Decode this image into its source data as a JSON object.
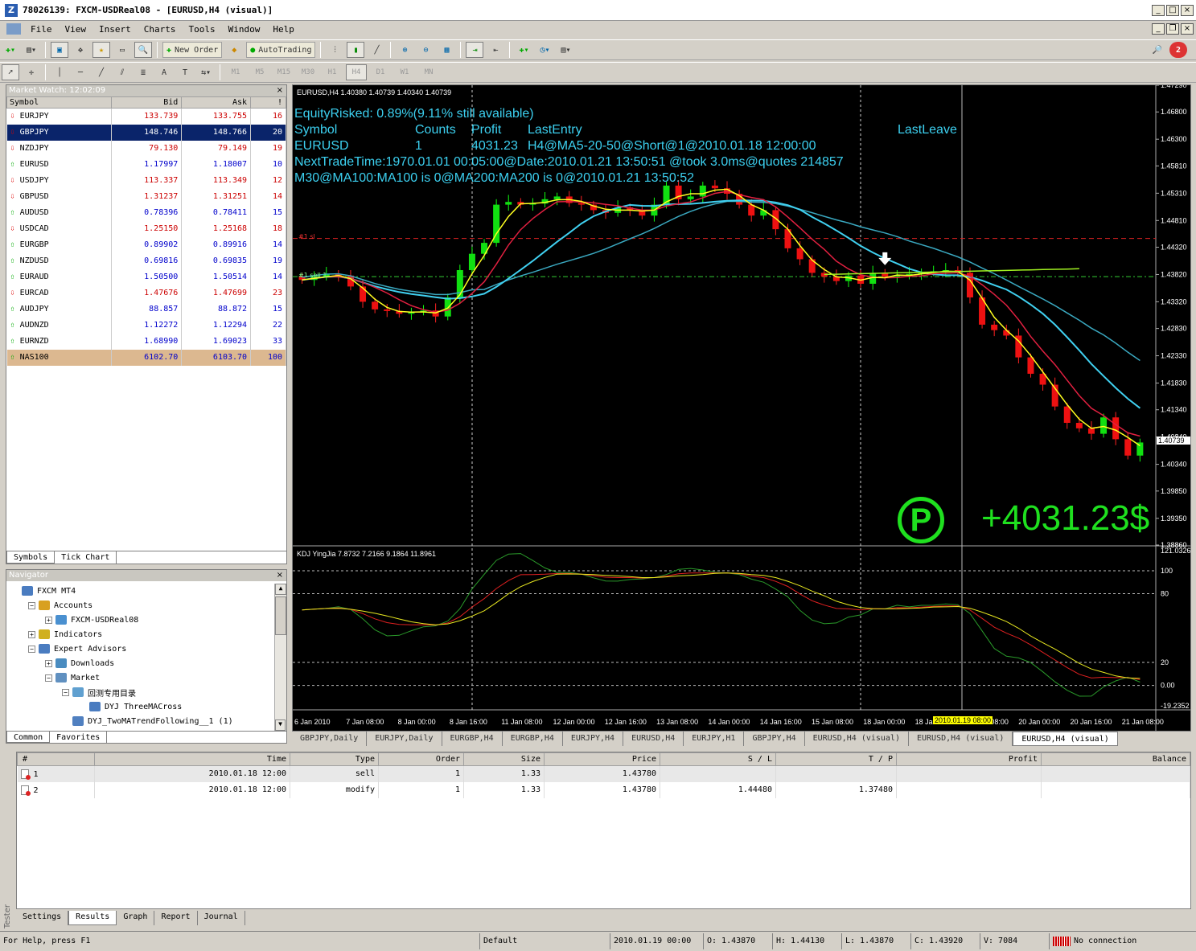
{
  "window": {
    "title": "78026139: FXCM-USDReal08 - [EURUSD,H4 (visual)]",
    "app_icon": "Z"
  },
  "menu": [
    "File",
    "View",
    "Insert",
    "Charts",
    "Tools",
    "Window",
    "Help"
  ],
  "toolbar": {
    "new_order": "New Order",
    "autotrading": "AutoTrading",
    "timeframes": [
      "M1",
      "M5",
      "M15",
      "M30",
      "H1",
      "H4",
      "D1",
      "W1",
      "MN"
    ],
    "alert_count": "2"
  },
  "market_watch": {
    "title": "Market Watch: 12:02:09",
    "close": "×",
    "columns": [
      "Symbol",
      "Bid",
      "Ask",
      "!"
    ],
    "rows": [
      {
        "symbol": "EURJPY",
        "bid": "133.739",
        "ask": "133.755",
        "spread": "16",
        "dir": "down"
      },
      {
        "symbol": "GBPJPY",
        "bid": "148.746",
        "ask": "148.766",
        "spread": "20",
        "dir": "down"
      },
      {
        "symbol": "NZDJPY",
        "bid": "79.130",
        "ask": "79.149",
        "spread": "19",
        "dir": "down"
      },
      {
        "symbol": "EURUSD",
        "bid": "1.17997",
        "ask": "1.18007",
        "spread": "10",
        "dir": "up"
      },
      {
        "symbol": "USDJPY",
        "bid": "113.337",
        "ask": "113.349",
        "spread": "12",
        "dir": "down"
      },
      {
        "symbol": "GBPUSD",
        "bid": "1.31237",
        "ask": "1.31251",
        "spread": "14",
        "dir": "down"
      },
      {
        "symbol": "AUDUSD",
        "bid": "0.78396",
        "ask": "0.78411",
        "spread": "15",
        "dir": "up"
      },
      {
        "symbol": "USDCAD",
        "bid": "1.25150",
        "ask": "1.25168",
        "spread": "18",
        "dir": "down"
      },
      {
        "symbol": "EURGBP",
        "bid": "0.89902",
        "ask": "0.89916",
        "spread": "14",
        "dir": "up"
      },
      {
        "symbol": "NZDUSD",
        "bid": "0.69816",
        "ask": "0.69835",
        "spread": "19",
        "dir": "up"
      },
      {
        "symbol": "EURAUD",
        "bid": "1.50500",
        "ask": "1.50514",
        "spread": "14",
        "dir": "up"
      },
      {
        "symbol": "EURCAD",
        "bid": "1.47676",
        "ask": "1.47699",
        "spread": "23",
        "dir": "down"
      },
      {
        "symbol": "AUDJPY",
        "bid": "88.857",
        "ask": "88.872",
        "spread": "15",
        "dir": "up"
      },
      {
        "symbol": "AUDNZD",
        "bid": "1.12272",
        "ask": "1.12294",
        "spread": "22",
        "dir": "up"
      },
      {
        "symbol": "EURNZD",
        "bid": "1.68990",
        "ask": "1.69023",
        "spread": "33",
        "dir": "up"
      },
      {
        "symbol": "NAS100",
        "bid": "6102.70",
        "ask": "6103.70",
        "spread": "100",
        "dir": "up"
      }
    ],
    "tabs": [
      "Symbols",
      "Tick Chart"
    ]
  },
  "navigator": {
    "title": "Navigator",
    "close": "×",
    "items": [
      {
        "label": "FXCM MT4",
        "level": 0,
        "exp": ""
      },
      {
        "label": "Accounts",
        "level": 1,
        "exp": "-"
      },
      {
        "label": "FXCM-USDReal08",
        "level": 2,
        "exp": "+"
      },
      {
        "label": "Indicators",
        "level": 1,
        "exp": "+"
      },
      {
        "label": "Expert Advisors",
        "level": 1,
        "exp": "-"
      },
      {
        "label": "Downloads",
        "level": 2,
        "exp": "+"
      },
      {
        "label": "Market",
        "level": 2,
        "exp": "-"
      },
      {
        "label": "回测专用目录",
        "level": 3,
        "exp": "-"
      },
      {
        "label": "DYJ ThreeMACross",
        "level": 4,
        "exp": ""
      },
      {
        "label": "DYJ_TwoMATrendFollowing__1 (1)",
        "level": 3,
        "exp": ""
      }
    ],
    "tabs": [
      "Common",
      "Favorites"
    ]
  },
  "chart": {
    "header": "EURUSD,H4  1.40380 1.40739 1.40340 1.40739",
    "info_lines": {
      "equity": "EquityRisked: 0.89%(9.11% still available)",
      "hdr_symbol": "Symbol",
      "hdr_counts": "Counts",
      "hdr_profit": "Profit",
      "hdr_lastentry": "LastEntry",
      "hdr_lastleave": "LastLeave",
      "row_symbol": "EURUSD",
      "row_counts": "1",
      "row_profit": "4031.23",
      "row_lastentry": "H4@MA5-20-50@Short@1@2010.01.18 12:00:00",
      "next": "NextTradeTime:1970.01.01 00:05:00@Date:2010.01.21 13:50:51 @took 3.0ms@quotes 214857",
      "m30": "M30@MA100:MA100 is 0@MA200:MA200 is 0@2010.01.21 13:50:52"
    },
    "sl_label": "#1 sl",
    "sell_label": "#1 sell 1.",
    "profit_big": "+4031.23$",
    "profit_badge": "P",
    "price_ticks": [
      "1.47290",
      "1.46800",
      "1.46300",
      "1.45810",
      "1.45310",
      "1.44810",
      "1.44320",
      "1.43820",
      "1.43320",
      "1.42830",
      "1.42330",
      "1.41830",
      "1.41340",
      "1.40840",
      "1.40340",
      "1.39850",
      "1.39350",
      "1.38860"
    ],
    "current_price": "1.40739",
    "ylim": [
      1.3886,
      1.4729
    ],
    "kdj": {
      "header": "KDJ YingJia 7.8732 7.2166 9.1864 11.8961",
      "ticks": [
        "121.0326",
        "100",
        "80",
        "20",
        "0.00",
        "-19.2352"
      ],
      "ylim": [
        -19.2352,
        121.0326
      ],
      "levels": [
        100,
        80,
        20,
        0
      ]
    },
    "time_labels": [
      "6 Jan 2010",
      "7 Jan 08:00",
      "8 Jan 00:00",
      "8 Jan 16:00",
      "11 Jan 08:00",
      "12 Jan 00:00",
      "12 Jan 16:00",
      "13 Jan 08:00",
      "14 Jan 00:00",
      "14 Jan 16:00",
      "15 Jan 08:00",
      "18 Jan 00:00",
      "18 Jan 16:00",
      "19 Jan 08:00",
      "20 Jan 00:00",
      "20 Jan 16:00",
      "21 Jan 08:00"
    ],
    "time_highlight": "2010.01.19 08:00"
  },
  "chart_tabs": [
    "GBPJPY,Daily",
    "EURJPY,Daily",
    "EURGBP,H4",
    "EURGBP,H4",
    "EURJPY,H4",
    "EURUSD,H4",
    "EURJPY,H1",
    "GBPJPY,H4",
    "EURUSD,H4 (visual)",
    "EURUSD,H4 (visual)",
    "EURUSD,H4 (visual)"
  ],
  "terminal": {
    "columns": [
      "#",
      "Time",
      "Type",
      "Order",
      "Size",
      "Price",
      "S / L",
      "T / P",
      "Profit",
      "Balance"
    ],
    "rows": [
      {
        "n": "1",
        "time": "2010.01.18 12:00",
        "type": "sell",
        "order": "1",
        "size": "1.33",
        "price": "1.43780",
        "sl": "",
        "tp": "",
        "profit": "",
        "balance": ""
      },
      {
        "n": "2",
        "time": "2010.01.18 12:00",
        "type": "modify",
        "order": "1",
        "size": "1.33",
        "price": "1.43780",
        "sl": "1.44480",
        "tp": "1.37480",
        "profit": "",
        "balance": ""
      }
    ],
    "side_label": "Tester",
    "tabs": [
      "Settings",
      "Results",
      "Graph",
      "Report",
      "Journal"
    ]
  },
  "status": {
    "help": "For Help, press F1",
    "profile": "Default",
    "datetime": "2010.01.19 00:00",
    "open": "O: 1.43870",
    "high": "H: 1.44130",
    "low": "L: 1.43870",
    "close": "C: 1.43920",
    "volume": "V: 7084",
    "connection": "No connection"
  },
  "chart_data": [
    {
      "type": "candlestick",
      "series": [
        {
          "name": "EURUSD,H4",
          "ohlc_close": [
            1.4372,
            1.4378,
            1.4383,
            1.438,
            1.436,
            1.4332,
            1.4318,
            1.4315,
            1.431,
            1.4314,
            1.4316,
            1.4305,
            1.434,
            1.439,
            1.442,
            1.444,
            1.451,
            1.4515,
            1.451,
            1.4512,
            1.452,
            1.4525,
            1.4513,
            1.451,
            1.45,
            1.4495,
            1.4505,
            1.45,
            1.449,
            1.451,
            1.4545,
            1.452,
            1.4525,
            1.4545,
            1.454,
            1.453,
            1.451,
            1.449,
            1.45,
            1.4465,
            1.443,
            1.441,
            1.4385,
            1.4378,
            1.437,
            1.438,
            1.4365,
            1.4385,
            1.4378,
            1.438,
            1.4383,
            1.4386,
            1.4388,
            1.439,
            1.4385,
            1.434,
            1.429,
            1.428,
            1.427,
            1.423,
            1.42,
            1.418,
            1.414,
            1.411,
            1.41,
            1.409,
            1.412,
            1.408,
            1.405,
            1.4074
          ]
        }
      ],
      "ylim": [
        1.3886,
        1.4729
      ]
    },
    {
      "type": "line",
      "title": "KDJ YingJia 7.8732 7.2166 9.1864 11.8961",
      "ylim": [
        -19.2352,
        121.0326
      ]
    }
  ]
}
